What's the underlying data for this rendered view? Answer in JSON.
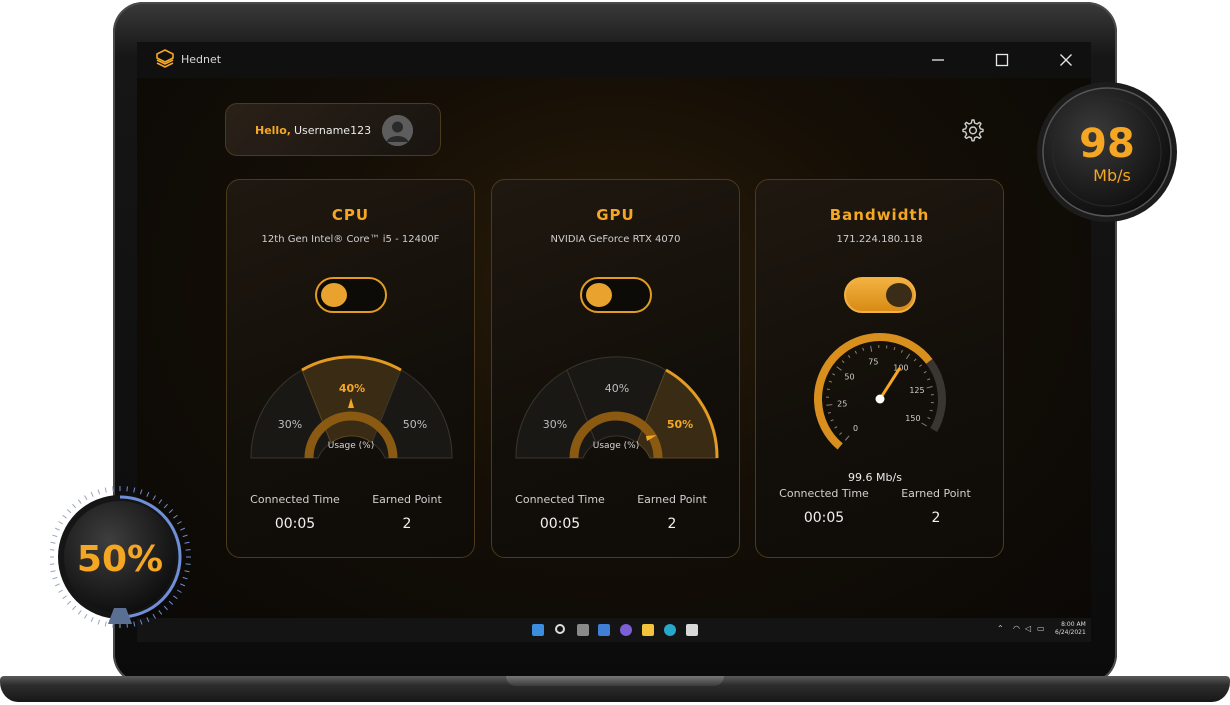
{
  "app": {
    "title": "Hednet"
  },
  "greeting": {
    "hello": "Hello,",
    "username": "Username123"
  },
  "colors": {
    "accent": "#f5a623",
    "accent_dark": "#c47a12",
    "panel": "#1a140d",
    "text": "#eaeaea"
  },
  "cards": [
    {
      "id": "cpu",
      "title": "CPU",
      "subtitle": "12th Gen Intel® Core™ i5 - 12400F",
      "toggle_on": false,
      "gauge": {
        "segments": [
          "30%",
          "40%",
          "50%"
        ],
        "active": "40%",
        "label": "Usage (%)"
      },
      "stats": {
        "connected_label": "Connected Time",
        "connected_value": "00:05",
        "points_label": "Earned Point",
        "points_value": "2"
      }
    },
    {
      "id": "gpu",
      "title": "GPU",
      "subtitle": "NVIDIA GeForce RTX 4070",
      "toggle_on": false,
      "gauge": {
        "segments": [
          "30%",
          "40%",
          "50%"
        ],
        "active": "50%",
        "label": "Usage (%)"
      },
      "stats": {
        "connected_label": "Connected Time",
        "connected_value": "00:05",
        "points_label": "Earned Point",
        "points_value": "2"
      }
    },
    {
      "id": "bandwidth",
      "title": "Bandwidth",
      "subtitle": "171.224.180.118",
      "toggle_on": true,
      "speedometer": {
        "ticks": [
          "0",
          "25",
          "50",
          "75",
          "100",
          "125",
          "150"
        ],
        "min": 0,
        "max": 150,
        "value": 99.6,
        "readout": "99.6 Mb/s"
      },
      "stats": {
        "connected_label": "Connected Time",
        "connected_value": "00:05",
        "points_label": "Earned Point",
        "points_value": "2"
      }
    }
  ],
  "badges": {
    "speed": {
      "value": "98",
      "unit": "Mb/s"
    },
    "percent": {
      "value": "50%",
      "level": 0.5
    }
  },
  "taskbar": {
    "icons": [
      "windows-start-icon",
      "search-icon",
      "task-view-icon",
      "widgets-icon",
      "chat-icon",
      "file-explorer-icon",
      "edge-browser-icon",
      "store-icon"
    ],
    "clock": {
      "time": "8:00 AM",
      "date": "6/24/2021"
    }
  }
}
